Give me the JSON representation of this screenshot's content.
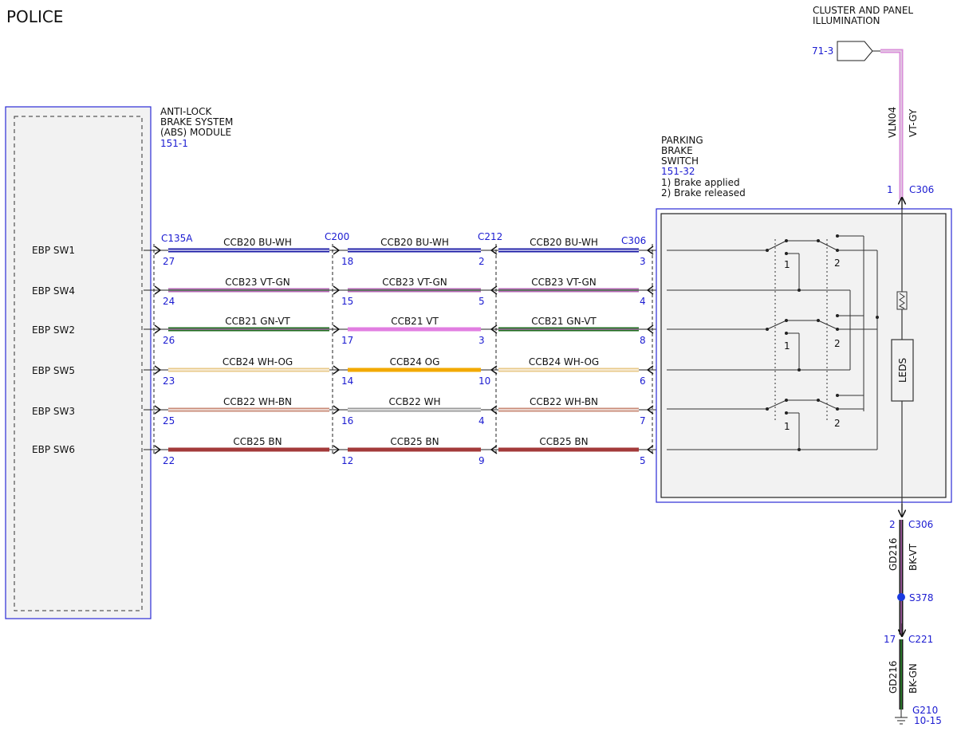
{
  "page_title": "POLICE",
  "abs_module": {
    "title_lines": [
      "ANTI-LOCK",
      "BRAKE SYSTEM",
      "(ABS) MODULE"
    ],
    "ref": "151-1",
    "pins": [
      "EBP SW1",
      "EBP SW4",
      "EBP SW2",
      "EBP SW5",
      "EBP SW3",
      "EBP SW6"
    ]
  },
  "connectors": {
    "c135a": "C135A",
    "c200": "C200",
    "c212": "C212",
    "c306": "C306"
  },
  "circuits": [
    {
      "seg1": "CCB20  BU-WH",
      "seg2": "CCB20  BU-WH",
      "seg3": "CCB20  BU-WH",
      "pins": [
        "27",
        "18",
        "2",
        "3"
      ],
      "sw": "SW1",
      "colors": [
        "#1a1aa6",
        "#1a1aa6",
        "#1a1aa6"
      ],
      "stripes": [
        "#ffffff",
        "#ffffff",
        "#ffffff"
      ]
    },
    {
      "seg1": "CCB23  VT-GN",
      "seg2": "CCB23  VT-GN",
      "seg3": "CCB23  VT-GN",
      "pins": [
        "24",
        "15",
        "5",
        "4"
      ],
      "sw": "SW4",
      "colors": [
        "#b366b3",
        "#b366b3",
        "#b366b3"
      ],
      "stripes": [
        "#2e7d32",
        "#2e7d32",
        "#2e7d32"
      ]
    },
    {
      "seg1": "CCB21  GN-VT",
      "seg2": "CCB21  VT",
      "seg3": "CCB21  GN-VT",
      "pins": [
        "26",
        "17",
        "3",
        "8"
      ],
      "sw": "SW2",
      "colors": [
        "#1f6e1f",
        "#e17ee1",
        "#1f6e1f"
      ],
      "stripes": [
        "#c26ec2",
        "#e17ee1",
        "#c26ec2"
      ]
    },
    {
      "seg1": "CCB24  WH-OG",
      "seg2": "CCB24  OG",
      "seg3": "CCB24  WH-OG",
      "pins": [
        "23",
        "14",
        "10",
        "6"
      ],
      "sw": "SW5",
      "colors": [
        "#e8c98a",
        "#f2a900",
        "#e8c98a"
      ],
      "stripes": [
        "#ffffff",
        "#f2a900",
        "#ffffff"
      ]
    },
    {
      "seg1": "CCB22  WH-BN",
      "seg2": "CCB22  WH",
      "seg3": "CCB22  WH-BN",
      "pins": [
        "25",
        "16",
        "4",
        "7"
      ],
      "sw": "SW3",
      "colors": [
        "#c98b78",
        "#9a9a9a",
        "#c98b78"
      ],
      "stripes": [
        "#ffffff",
        "#ffffff",
        "#ffffff"
      ]
    },
    {
      "seg1": "CCB25  BN",
      "seg2": "CCB25  BN",
      "seg3": "CCB25  BN",
      "pins": [
        "22",
        "12",
        "9",
        "5"
      ],
      "sw": "SW6",
      "colors": [
        "#a33a3a",
        "#a33a3a",
        "#a33a3a"
      ],
      "stripes": [
        "#a33a3a",
        "#a33a3a",
        "#a33a3a"
      ]
    }
  ],
  "parking_brake_switch": {
    "title_lines": [
      "PARKING",
      "BRAKE",
      "SWITCH"
    ],
    "ref": "151-32",
    "notes": [
      "1) Brake applied",
      "2) Brake released"
    ],
    "pos1": "1",
    "pos2": "2",
    "leds": "LEDS"
  },
  "cluster": {
    "title_lines": [
      "CLUSTER AND PANEL",
      "ILLUMINATION"
    ],
    "ref": "71-3",
    "circuit": "VLN04",
    "color_code": "VT-GY",
    "wire_color": "#d98ed9",
    "pin": "1",
    "connector": "C306"
  },
  "ground_path": {
    "c306_pin": "2",
    "c306": "C306",
    "seg1_circuit": "GD216",
    "seg1_color": "BK-VT",
    "splice": "S378",
    "c221_pin": "17",
    "c221": "C221",
    "seg2_circuit": "GD216",
    "seg2_color": "BK-GN",
    "ground": "G210",
    "ground_ref": "10-15",
    "splice_color": "#1a3ae0"
  },
  "accent_colors": {
    "connector_text": "#1b1bd1",
    "module_border": "#2a2ad6"
  }
}
